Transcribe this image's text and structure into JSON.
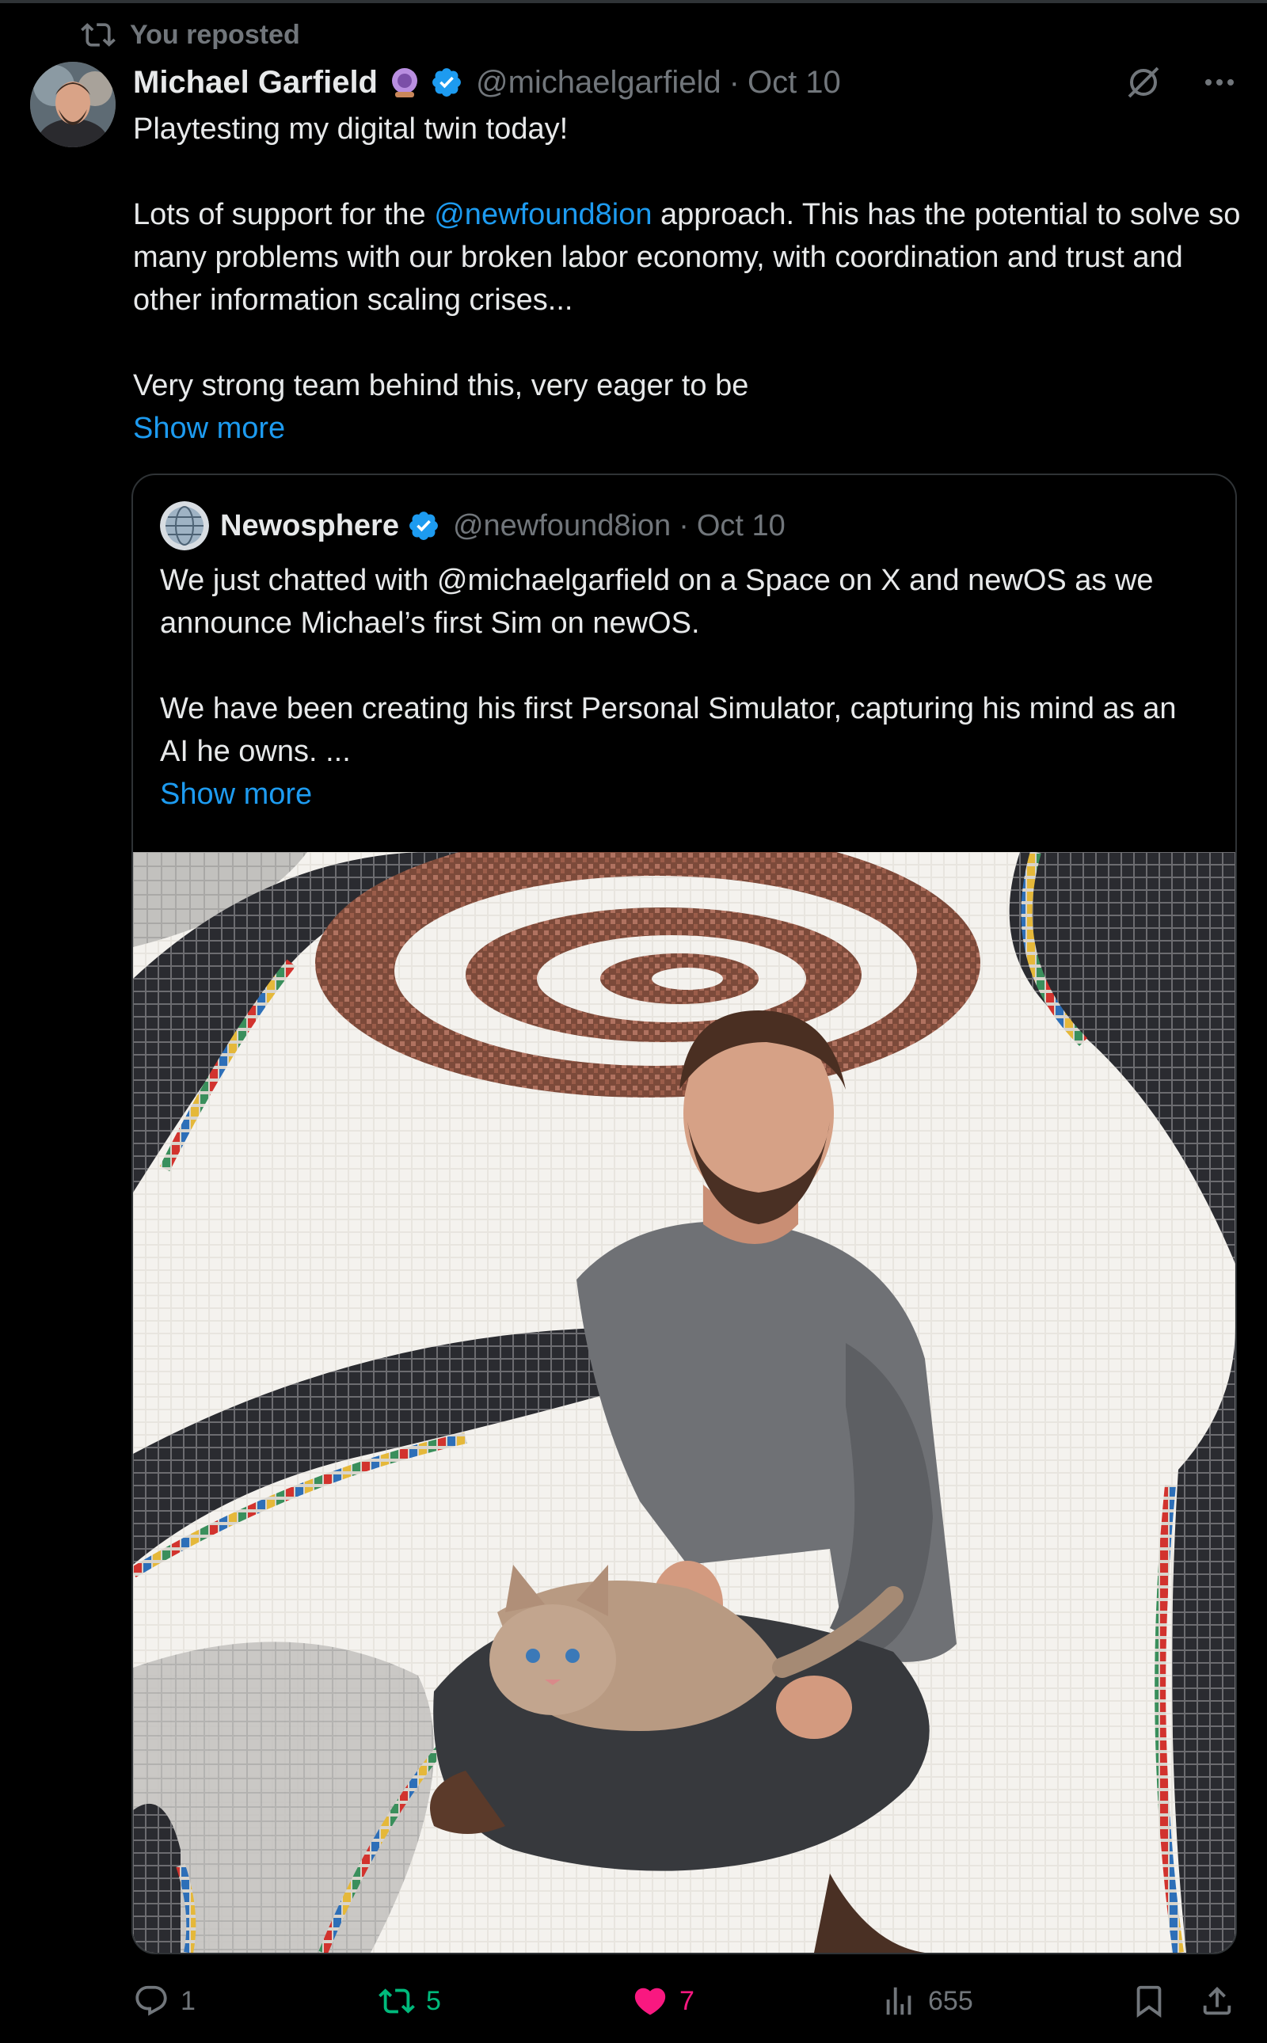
{
  "repost_banner": {
    "label": "You reposted",
    "icon": "repost-icon"
  },
  "tweet": {
    "author_name": "Michael Garfield",
    "handle": "@michaelgarfield",
    "separator": "·",
    "date": "Oct 10",
    "text_line1": "Playtesting my digital twin today!",
    "text_p2_before": "Lots of support for the ",
    "text_p2_mention": "@newfound8ion",
    "text_p2_after": " approach. This has the potential to solve so many problems with our broken labor economy, with coordination and trust and other information scaling crises...",
    "text_p3": "Very strong team behind this, very eager to be",
    "show_more": "Show more"
  },
  "quote": {
    "author_name": "Newosphere",
    "handle": "@newfound8ion",
    "separator": "·",
    "date": "Oct 10",
    "text_p1": "We just chatted with @michaelgarfield on a Space on X and newOS as we announce Michael’s first Sim on newOS.",
    "text_p2": "We have been creating his first Personal Simulator, capturing his mind as an AI he owns. ...",
    "show_more": "Show more",
    "image_alt": "Mosaic floor with swirling patterns; man sitting cross-legged holding a kitten"
  },
  "actions": {
    "replies": "1",
    "reposts": "5",
    "likes": "7",
    "views": "655"
  },
  "colors": {
    "background": "#000000",
    "text": "#e7e9ea",
    "muted": "#71767b",
    "link": "#1d9bf0",
    "verified": "#1d9bf0",
    "repost_active": "#00ba7c",
    "like_active": "#f91880",
    "border": "#2f3336"
  },
  "icons": [
    "repost-icon",
    "verified-badge-icon",
    "emoji-badge-icon",
    "grok-icon",
    "more-icon",
    "reply-icon",
    "like-icon",
    "views-icon",
    "bookmark-icon",
    "share-icon"
  ]
}
